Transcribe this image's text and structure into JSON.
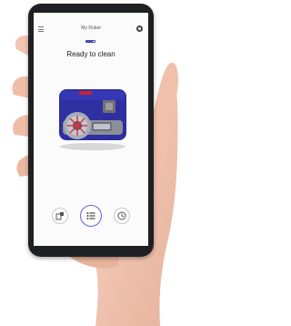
{
  "app": {
    "title": "My Robot",
    "status": "Ready to clean",
    "battery_level": 0.75
  },
  "nav": {
    "items": [
      {
        "icon": "robot-map-icon",
        "active": false
      },
      {
        "icon": "list-icon",
        "active": true
      },
      {
        "icon": "clock-icon",
        "active": false
      }
    ]
  },
  "colors": {
    "accent": "#5b63d9",
    "robot_body": "#2e2fa0",
    "robot_accent": "#c8232c",
    "phone_frame": "#1f2023",
    "skin": "#f2c5b0"
  }
}
